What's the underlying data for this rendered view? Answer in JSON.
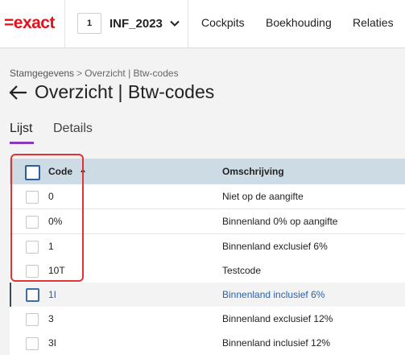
{
  "app": {
    "logo_text": "=exact",
    "admin_number": "1",
    "admin_name": "INF_2023",
    "nav": [
      "Cockpits",
      "Boekhouding",
      "Relaties"
    ]
  },
  "breadcrumb": {
    "root": "Stamgegevens",
    "separator": ">",
    "current": "Overzicht | Btw-codes"
  },
  "page": {
    "title": "Overzicht | Btw-codes"
  },
  "tabs": [
    {
      "label": "Lijst",
      "active": true
    },
    {
      "label": "Details",
      "active": false
    }
  ],
  "grid": {
    "columns": {
      "code": "Code",
      "description": "Omschrijving"
    },
    "rows": [
      {
        "code": "0",
        "description": "Niet op de aangifte"
      },
      {
        "code": "0%",
        "description": "Binnenland 0% op aangifte"
      },
      {
        "code": "1",
        "description": "Binnenland exclusief 6%"
      },
      {
        "code": "10T",
        "description": "Testcode"
      },
      {
        "code": "1I",
        "description": "Binnenland inclusief 6%"
      },
      {
        "code": "3",
        "description": "Binnenland exclusief 12%"
      },
      {
        "code": "3I",
        "description": "Binnenland inclusief 12%"
      }
    ]
  },
  "colors": {
    "brand": "#e3111b",
    "accent": "#8a3ab9",
    "link": "#2a62a8",
    "header_bg": "#cddbe5",
    "highlight": "#e23232"
  }
}
